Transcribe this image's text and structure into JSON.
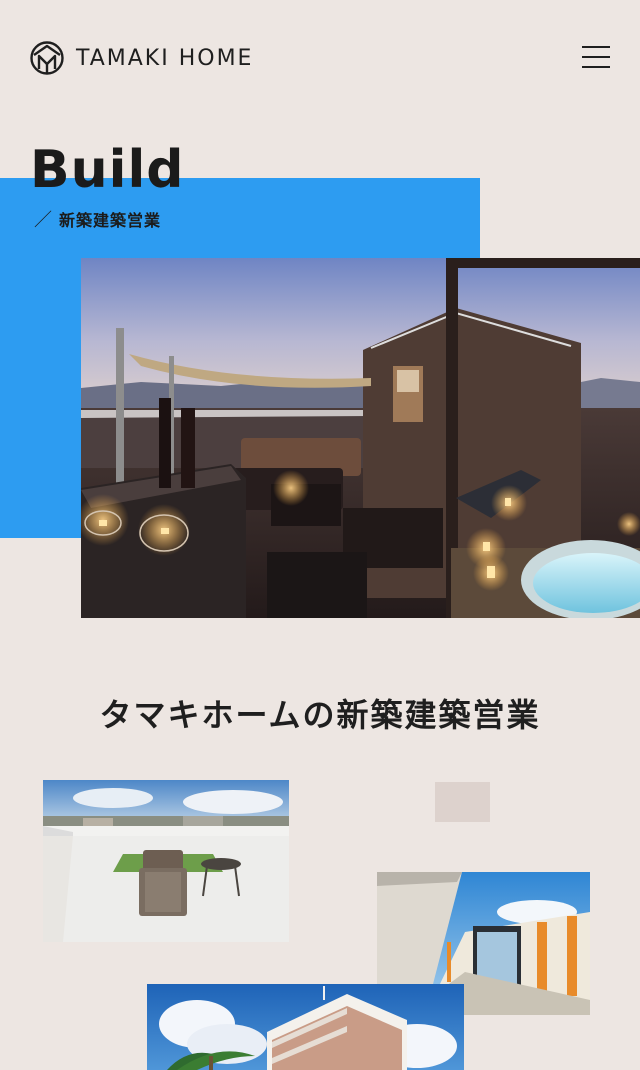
{
  "header": {
    "logo_text": "TAMAKI HOME",
    "logo_icon": "tamaki-home-logo-icon",
    "menu_icon": "hamburger-menu-icon"
  },
  "hero": {
    "title": "Build",
    "subtitle": "新築建築営業",
    "accent_color": "#2d9cf1"
  },
  "section": {
    "title": "タマキホームの新築建築営業"
  },
  "colors": {
    "background": "#ede6e2",
    "accent_blue": "#2d9cf1",
    "text": "#1f1f1f",
    "placeholder": "#ddd2cd"
  }
}
